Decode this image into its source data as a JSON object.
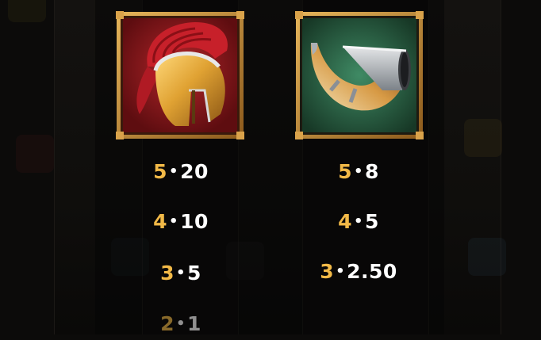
{
  "paytable": {
    "symbols": [
      {
        "name": "Spartan Helmet",
        "frame_color": "#8e1a1c",
        "pays": [
          {
            "count": "5",
            "value": "20"
          },
          {
            "count": "4",
            "value": "10"
          },
          {
            "count": "3",
            "value": "5"
          },
          {
            "count": "2",
            "value": "1"
          }
        ]
      },
      {
        "name": "War Horn",
        "frame_color": "#1f4d38",
        "pays": [
          {
            "count": "5",
            "value": "8"
          },
          {
            "count": "4",
            "value": "5"
          },
          {
            "count": "3",
            "value": "2.50"
          }
        ]
      }
    ],
    "separator": "•",
    "colors": {
      "count": "#f2b947",
      "value": "#ffffff",
      "frame_gold": "#c48a2e"
    }
  }
}
